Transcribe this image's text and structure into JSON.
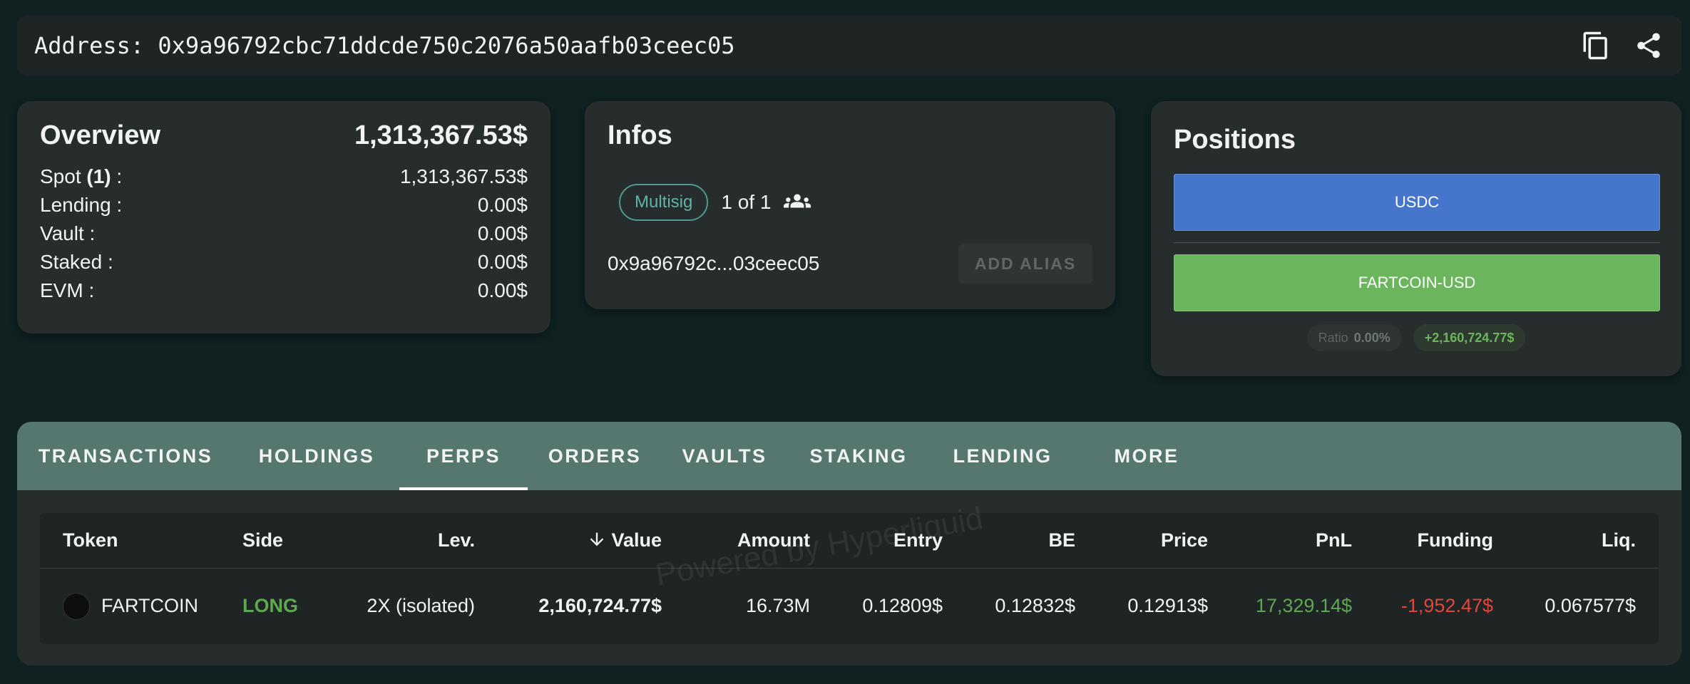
{
  "address_bar": {
    "label": "Address: 0x9a96792cbc71ddcde750c2076a50aafb03ceec05",
    "copy_icon": "copy-icon",
    "share_icon": "share-icon"
  },
  "overview": {
    "title": "Overview",
    "total": "1,313,367.53$",
    "rows": [
      {
        "label_prefix": "Spot ",
        "label_bold": "(1)",
        "label_suffix": " :",
        "value": "1,313,367.53$"
      },
      {
        "label": "Lending :",
        "value": "0.00$"
      },
      {
        "label": "Vault :",
        "value": "0.00$"
      },
      {
        "label": "Staked :",
        "value": "0.00$"
      },
      {
        "label": "EVM :",
        "value": "0.00$"
      }
    ]
  },
  "infos": {
    "title": "Infos",
    "multisig_chip": "Multisig",
    "multisig_count": "1 of 1",
    "short_address": "0x9a96792c...03ceec05",
    "add_alias_label": "ADD ALIAS"
  },
  "positions": {
    "title": "Positions",
    "bars": [
      {
        "label": "USDC",
        "color": "#4675cc"
      },
      {
        "label": "FARTCOIN-USD",
        "color": "#6bb55d"
      }
    ],
    "ratio_label": "Ratio",
    "ratio_value": "0.00%",
    "pnl_badge": "+2,160,724.77$"
  },
  "tabs": [
    "TRANSACTIONS",
    "HOLDINGS",
    "PERPS",
    "ORDERS",
    "VAULTS",
    "STAKING",
    "LENDING",
    "MORE"
  ],
  "active_tab": "PERPS",
  "table": {
    "headers": {
      "token": "Token",
      "side": "Side",
      "lev": "Lev.",
      "value": "Value",
      "amount": "Amount",
      "entry": "Entry",
      "be": "BE",
      "price": "Price",
      "pnl": "PnL",
      "funding": "Funding",
      "liq": "Liq."
    },
    "rows": [
      {
        "token": "FARTCOIN",
        "side": "LONG",
        "lev": "2X (isolated)",
        "value": "2,160,724.77$",
        "amount": "16.73M",
        "entry": "0.12809$",
        "be": "0.12832$",
        "price": "0.12913$",
        "pnl": "17,329.14$",
        "funding": "-1,952.47$",
        "liq": "0.067577$"
      }
    ]
  },
  "watermark": "Powered by Hyperliquid",
  "colors": {
    "background": "#0f2121",
    "card": "#272c2c",
    "tab_bar": "#55776f",
    "positive": "#5ea851",
    "negative": "#e2453a"
  }
}
